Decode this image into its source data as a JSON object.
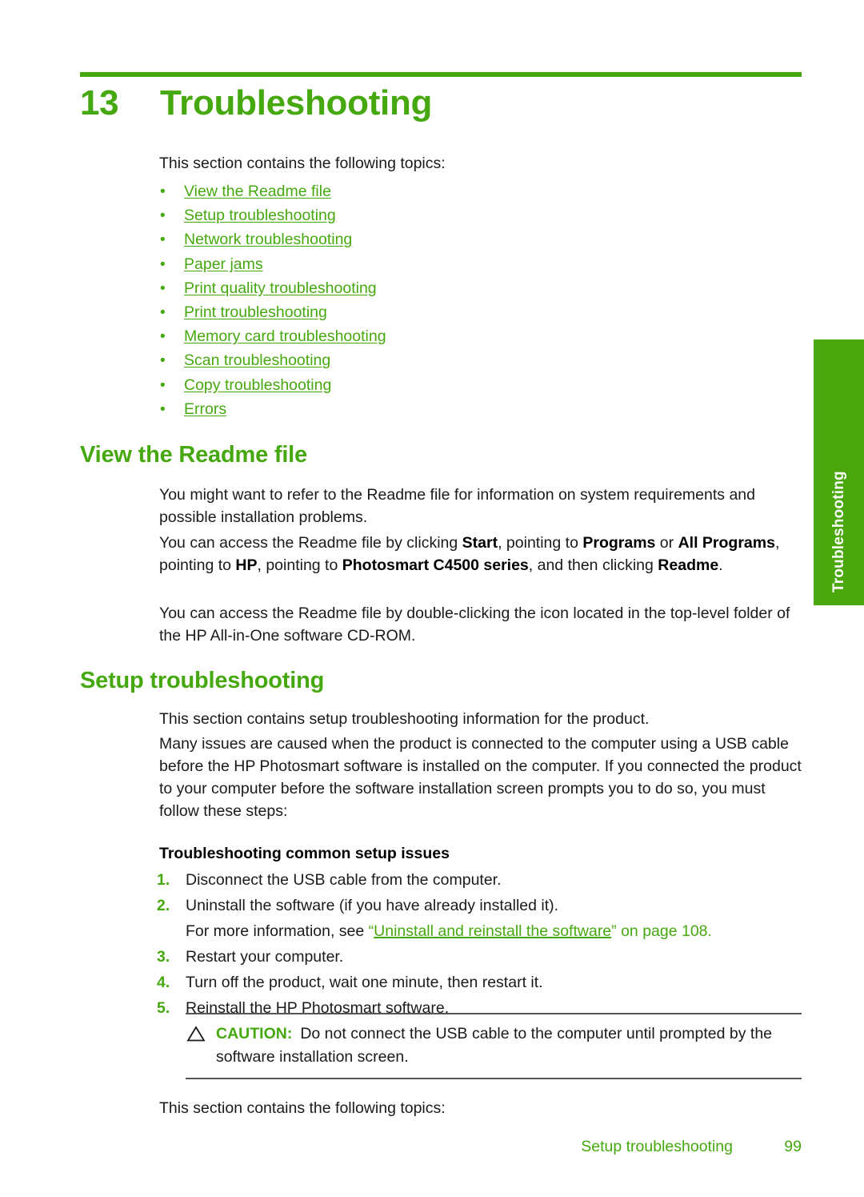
{
  "chapter": {
    "number": "13",
    "title": "Troubleshooting",
    "intro": "This section contains the following topics:"
  },
  "topics": [
    {
      "label": "View the Readme file"
    },
    {
      "label": "Setup troubleshooting"
    },
    {
      "label": "Network troubleshooting"
    },
    {
      "label": "Paper jams"
    },
    {
      "label": "Print quality troubleshooting"
    },
    {
      "label": "Print troubleshooting"
    },
    {
      "label": "Memory card troubleshooting"
    },
    {
      "label": "Scan troubleshooting"
    },
    {
      "label": "Copy troubleshooting"
    },
    {
      "label": "Errors"
    }
  ],
  "bullet_glyph": "•",
  "readme_section": {
    "heading": "View the Readme file",
    "paragraph_1": "You might want to refer to the Readme file for information on system requirements and possible installation problems.",
    "paragraph_2": {
      "part_1": "You can access the Readme file by clicking ",
      "bold_1": "Start",
      "part_2": ", pointing to ",
      "bold_2": "Programs",
      "part_3": " or ",
      "bold_3": "All Programs",
      "part_4": ", pointing to ",
      "bold_4": "HP",
      "part_5": ", pointing to ",
      "bold_5": "Photosmart C4500 series",
      "part_6": ", and then clicking ",
      "bold_6": "Readme",
      "part_7": "."
    },
    "paragraph_3": "You can access the Readme file by double-clicking the icon located in the top-level folder of the HP All-in-One software CD-ROM."
  },
  "setup_section": {
    "heading": "Setup troubleshooting",
    "paragraph_1": "This section contains setup troubleshooting information for the product.",
    "paragraph_2": "Many issues are caused when the product is connected to the computer using a USB cable before the HP Photosmart software is installed on the computer. If you connected the product to your computer before the software installation screen prompts you to do so, you must follow these steps:",
    "sub_heading": "Troubleshooting common setup issues",
    "steps": [
      {
        "number": "1.",
        "text": "Disconnect the USB cable from the computer."
      },
      {
        "number": "2.",
        "text": "Uninstall the software (if you have already installed it)."
      },
      {
        "number": "3.",
        "text": "Restart your computer."
      },
      {
        "number": "4.",
        "text": "Turn off the product, wait one minute, then restart it."
      },
      {
        "number": "5.",
        "text": "Reinstall the HP Photosmart software."
      }
    ],
    "step_2_note": {
      "lead": "For more information, see ",
      "open_quote": "“",
      "link": "Uninstall and reinstall the software",
      "close_quote": "”",
      "tail": " on page 108."
    },
    "caution": {
      "icon": "warning-triangle-icon",
      "label": "CAUTION:",
      "text": "Do not connect the USB cable to the computer until prompted by the software installation screen."
    },
    "closing_paragraph": "This section contains the following topics:"
  },
  "thumb_tab": {
    "label": "Troubleshooting"
  },
  "footer": {
    "section_label": "Setup troubleshooting",
    "page_number": "99"
  },
  "colors": {
    "accent_green": "#46a80f",
    "tab_green": "#4aa80c",
    "body_black": "#1a1a1a",
    "rule_gray": "#555555"
  }
}
